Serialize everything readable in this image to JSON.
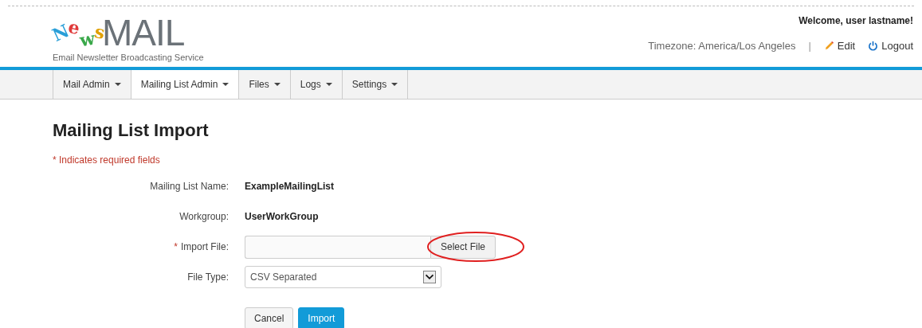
{
  "logo": {
    "letters": [
      {
        "text": "N",
        "color": "#2a9fd8"
      },
      {
        "text": "e",
        "color": "#e03a3a"
      },
      {
        "text": "w",
        "color": "#3aa84a"
      },
      {
        "text": "s",
        "color": "#e0a000"
      }
    ],
    "word": "MAIL",
    "tagline": "Email Newsletter Broadcasting Service"
  },
  "header": {
    "welcome": "Welcome, user lastname!",
    "timezone": "Timezone: America/Los Angeles",
    "separator": "|",
    "edit": "Edit",
    "logout": "Logout"
  },
  "nav": [
    {
      "label": "Mail Admin",
      "selected": false
    },
    {
      "label": "Mailing List Admin",
      "selected": true
    },
    {
      "label": "Files",
      "selected": false
    },
    {
      "label": "Logs",
      "selected": false
    },
    {
      "label": "Settings",
      "selected": false
    }
  ],
  "page": {
    "title": "Mailing List Import",
    "required_note": "* Indicates required fields"
  },
  "form": [
    {
      "kind": "static",
      "label": "Mailing List Name:",
      "value": "ExampleMailingList"
    },
    {
      "kind": "static",
      "label": "Workgroup:",
      "value": "UserWorkGroup"
    },
    {
      "kind": "file",
      "label": "Import File:",
      "required_mark": "*",
      "button": "Select File",
      "highlighted": true
    },
    {
      "kind": "select",
      "label": "File Type:",
      "value": "CSV Separated"
    }
  ],
  "buttons": [
    {
      "label": "Cancel",
      "kind": "default"
    },
    {
      "label": "Import",
      "kind": "primary"
    }
  ]
}
